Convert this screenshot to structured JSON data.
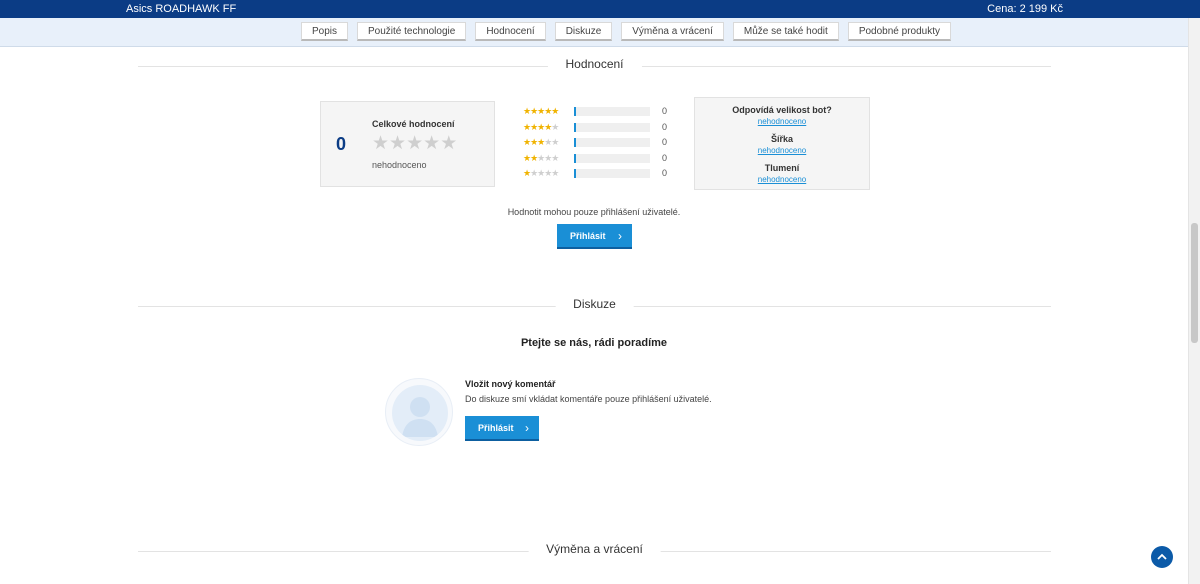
{
  "header": {
    "product_title": "Asics ROADHAWK FF",
    "price": "Cena: 2 199 Kč"
  },
  "tabs": [
    {
      "label": "Popis"
    },
    {
      "label": "Použité technologie"
    },
    {
      "label": "Hodnocení"
    },
    {
      "label": "Diskuze"
    },
    {
      "label": "Výměna a vrácení"
    },
    {
      "label": "Může se také hodit"
    },
    {
      "label": "Podobné produkty"
    }
  ],
  "rating": {
    "section_title": "Hodnocení",
    "overall_label": "Celkové hodnocení",
    "overall_value": "0",
    "overall_status": "nehodnoceno",
    "distribution": [
      {
        "stars": 5,
        "count": "0"
      },
      {
        "stars": 4,
        "count": "0"
      },
      {
        "stars": 3,
        "count": "0"
      },
      {
        "stars": 2,
        "count": "0"
      },
      {
        "stars": 1,
        "count": "0"
      }
    ],
    "size_questions": [
      {
        "question": "Odpovídá velikost bot?",
        "value": "nehodnoceno"
      },
      {
        "question": "Šířka",
        "value": "nehodnoceno"
      },
      {
        "question": "Tlumení",
        "value": "nehodnoceno"
      }
    ],
    "login_note": "Hodnotit mohou pouze přihlášení uživatelé.",
    "login_button": "Přihlásit"
  },
  "discussion": {
    "section_title": "Diskuze",
    "headline": "Ptejte se nás, rádi poradíme",
    "new_comment_title": "Vložit nový komentář",
    "new_comment_note": "Do diskuze smí vkládat komentáře pouze přihlášení uživatelé.",
    "login_button": "Přihlásit"
  },
  "exchange": {
    "section_title": "Výměna a vrácení"
  },
  "colors": {
    "brand": "#0b3c85",
    "accent": "#1a8fd6",
    "star": "#f0b300"
  },
  "icons": {
    "back_to_top": "chevron-up-icon",
    "button_arrow": "chevron-right-icon"
  }
}
